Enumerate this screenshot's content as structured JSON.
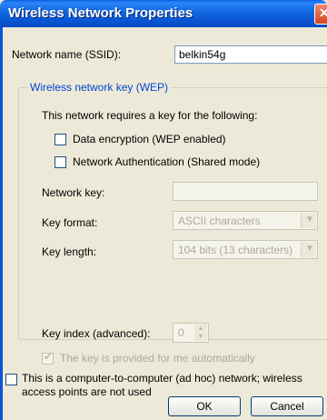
{
  "window": {
    "title": "Wireless Network Properties"
  },
  "ssid": {
    "label": "Network name (SSID):",
    "value": "belkin54g"
  },
  "wep": {
    "legend": "Wireless network key (WEP)",
    "requires_text": "This network requires a key for the following:",
    "data_encryption": {
      "label": "Data encryption (WEP enabled)",
      "checked": false
    },
    "network_auth": {
      "label": "Network Authentication (Shared mode)",
      "checked": false
    },
    "network_key_label": "Network key:",
    "network_key_value": "",
    "key_format_label": "Key format:",
    "key_format_value": "ASCII characters",
    "key_length_label": "Key length:",
    "key_length_value": "104 bits (13 characters)",
    "key_index_label": "Key index (advanced):",
    "key_index_value": "0",
    "auto_key_label": "The key is provided for me automatically",
    "auto_key_checked": true
  },
  "adhoc": {
    "label_line1": "This is a computer-to-computer (ad hoc) network; wireless",
    "label_line2": "access points are not used",
    "checked": false
  },
  "buttons": {
    "ok": "OK",
    "cancel": "Cancel"
  }
}
